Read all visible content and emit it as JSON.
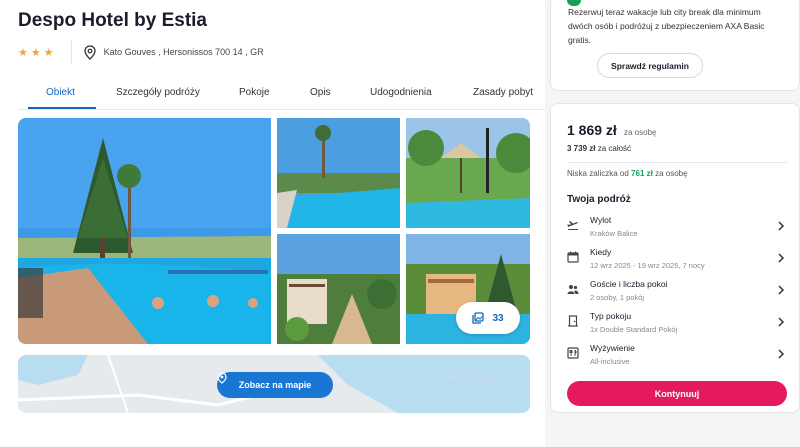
{
  "hotel": {
    "name": "Despo Hotel by Estia",
    "stars": "★★★",
    "address": "Kato Gouves , Hersonissos 700 14 , GR"
  },
  "tabs": [
    {
      "label": "Obiekt",
      "active": true
    },
    {
      "label": "Szczegóły podróży",
      "active": false
    },
    {
      "label": "Pokoje",
      "active": false
    },
    {
      "label": "Opis",
      "active": false
    },
    {
      "label": "Udogodnienia",
      "active": false
    },
    {
      "label": "Zasady pobyt",
      "active": false
    }
  ],
  "gallery": {
    "photo_count": "33"
  },
  "map": {
    "button_label": "Zobacz na mapie"
  },
  "promo": {
    "text": "Rezerwuj teraz wakacje lub city break dla minimum dwóch osób i podróżuj z ubezpieczeniem AXA Basic gratis.",
    "button_label": "Sprawdź regulamin"
  },
  "booking": {
    "price": "1 869 zł",
    "price_suffix": "za osobę",
    "total_amount": "3 739 zł",
    "total_suffix": "za całość",
    "deposit_prefix": "Niska zaliczka od",
    "deposit_amount": "761 zł",
    "deposit_suffix": "za osobę",
    "trip_title": "Twoja podróż",
    "rows": [
      {
        "label": "Wylot",
        "value": "Kraków Balice",
        "icon": "plane-icon"
      },
      {
        "label": "Kiedy",
        "value": "12 wrz 2025 - 19 wrz 2025, 7 nocy",
        "icon": "calendar-icon"
      },
      {
        "label": "Goście i liczba pokoi",
        "value": "2 osoby, 1 pokój",
        "icon": "guests-icon"
      },
      {
        "label": "Typ pokoju",
        "value": "1x Double Standard Pokój",
        "icon": "door-icon"
      },
      {
        "label": "Wyżywienie",
        "value": "All-inclusive",
        "icon": "food-icon"
      }
    ],
    "cta_label": "Kontynuuj"
  },
  "colors": {
    "accent_blue": "#1565c0",
    "cta_pink": "#e5195f",
    "green": "#17a05d",
    "stars": "#f2a33a"
  }
}
